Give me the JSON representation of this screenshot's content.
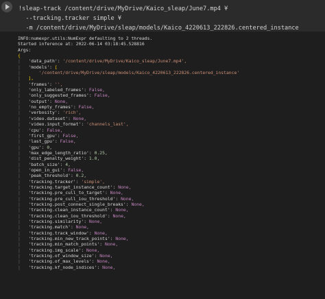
{
  "cell": {
    "run_button": "run-cell",
    "lines": [
      "!sleap-track /content/drive/MyDrive/Kaico_sleap/June7.mp4 ¥",
      "  --tracking.tracker simple ¥",
      "  -m /content/drive/MyDrive/sleap/models/Kaico_4220613_222826.centered_instance"
    ]
  },
  "output": {
    "info_lines": [
      "INFO:numexpr.utils:NumExpr defaulting to 2 threads.",
      "Started inference at: 2022-06-14 03:18:45.528816",
      "Args:"
    ],
    "open_brace": "{",
    "args": [
      {
        "k": "'data_path'",
        "v": "'/content/drive/MyDrive/Kaico_sleap/June7.mp4',",
        "t": "s"
      },
      {
        "k": "'models'",
        "v": "[",
        "t": "b"
      },
      {
        "k": "    '/content/drive/MyDrive/sleap/models/Kaico_4220613_222826.centered_instance'",
        "v": "",
        "t": "s"
      },
      {
        "k": "],",
        "v": "",
        "t": "b"
      },
      {
        "k": "'frames'",
        "v": "'',",
        "t": "s"
      },
      {
        "k": "'only_labeled_frames'",
        "v": "False,",
        "t": "f"
      },
      {
        "k": "'only_suggested_frames'",
        "v": "False,",
        "t": "f"
      },
      {
        "k": "'output'",
        "v": "None,",
        "t": "f"
      },
      {
        "k": "'no_empty_frames'",
        "v": "False,",
        "t": "f"
      },
      {
        "k": "'verbosity'",
        "v": "'rich',",
        "t": "s"
      },
      {
        "k": "'video.dataset'",
        "v": "None,",
        "t": "f"
      },
      {
        "k": "'video.input_format'",
        "v": "'channels_last',",
        "t": "s"
      },
      {
        "k": "'cpu'",
        "v": "False,",
        "t": "f"
      },
      {
        "k": "'first_gpu'",
        "v": "False,",
        "t": "f"
      },
      {
        "k": "'last_gpu'",
        "v": "False,",
        "t": "f"
      },
      {
        "k": "'gpu'",
        "v": "0,",
        "t": "n"
      },
      {
        "k": "'max_edge_length_ratio'",
        "v": "0.25,",
        "t": "n"
      },
      {
        "k": "'dist_penalty_weight'",
        "v": "1.0,",
        "t": "n"
      },
      {
        "k": "'batch_size'",
        "v": "4,",
        "t": "n"
      },
      {
        "k": "'open_in_gui'",
        "v": "False,",
        "t": "f"
      },
      {
        "k": "'peak_threshold'",
        "v": "0.2,",
        "t": "n"
      },
      {
        "k": "'tracking.tracker'",
        "v": "'simple',",
        "t": "s"
      },
      {
        "k": "'tracking.target_instance_count'",
        "v": "None,",
        "t": "f"
      },
      {
        "k": "'tracking.pre_cull_to_target'",
        "v": "None,",
        "t": "f"
      },
      {
        "k": "'tracking.pre_cull_iou_threshold'",
        "v": "None,",
        "t": "f"
      },
      {
        "k": "'tracking.post_connect_single_breaks'",
        "v": "None,",
        "t": "f"
      },
      {
        "k": "'tracking.clean_instance_count'",
        "v": "None,",
        "t": "f"
      },
      {
        "k": "'tracking.clean_iou_threshold'",
        "v": "None,",
        "t": "f"
      },
      {
        "k": "'tracking.similarity'",
        "v": "None,",
        "t": "f"
      },
      {
        "k": "'tracking.match'",
        "v": "None,",
        "t": "f"
      },
      {
        "k": "'tracking.track_window'",
        "v": "None,",
        "t": "f"
      },
      {
        "k": "'tracking.min_new_track_points'",
        "v": "None,",
        "t": "f"
      },
      {
        "k": "'tracking.min_match_points'",
        "v": "None,",
        "t": "f"
      },
      {
        "k": "'tracking.img_scale'",
        "v": "None,",
        "t": "f"
      },
      {
        "k": "'tracking.of_window_size'",
        "v": "None,",
        "t": "f"
      },
      {
        "k": "'tracking.of_max_levels'",
        "v": "None,",
        "t": "f"
      },
      {
        "k": "'tracking.kf_node_indices'",
        "v": "None,",
        "t": "f"
      }
    ]
  }
}
